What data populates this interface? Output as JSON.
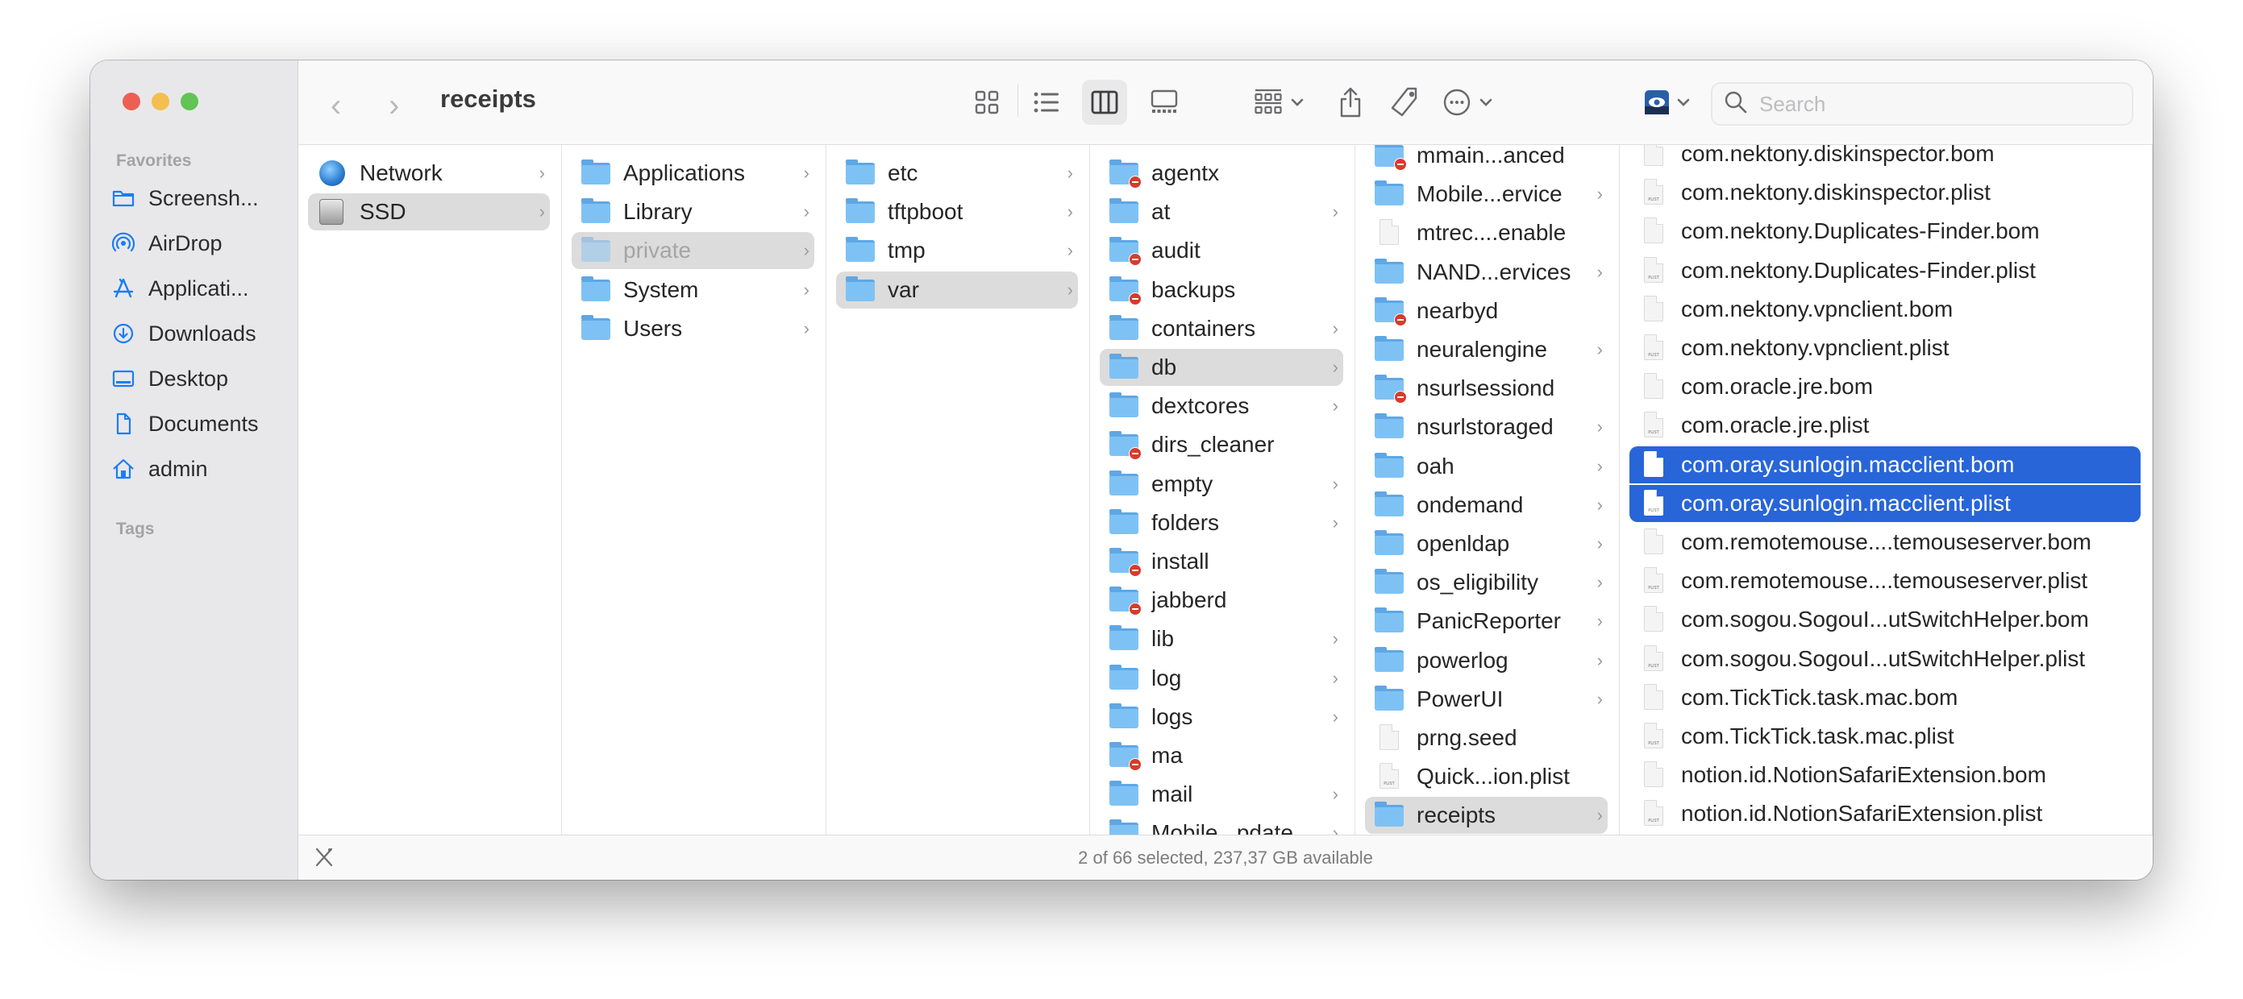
{
  "window": {
    "title": "receipts",
    "traffic_lights": [
      "close",
      "minimize",
      "zoom"
    ]
  },
  "sidebar": {
    "favorites_label": "Favorites",
    "tags_label": "Tags",
    "items": [
      {
        "label": "Screensh...",
        "icon": "folder-icon"
      },
      {
        "label": "AirDrop",
        "icon": "airdrop-icon"
      },
      {
        "label": "Applicati...",
        "icon": "applications-icon"
      },
      {
        "label": "Downloads",
        "icon": "download-icon"
      },
      {
        "label": "Desktop",
        "icon": "desktop-icon"
      },
      {
        "label": "Documents",
        "icon": "document-icon"
      },
      {
        "label": "admin",
        "icon": "home-icon"
      }
    ],
    "accent": "#1a7cf5"
  },
  "toolbar": {
    "back": "‹",
    "forward": "›",
    "view_modes": [
      "icon-view",
      "list-view",
      "column-view",
      "gallery-view"
    ],
    "active_view": "column-view",
    "group_by": "group-icon",
    "share": "share-icon",
    "tag": "tag-icon",
    "more": "more-icon",
    "preview": "preview-eye-icon",
    "search_placeholder": "Search",
    "search_value": ""
  },
  "columns": [
    {
      "items": [
        {
          "name": "Network",
          "type": "network",
          "arrow": true
        },
        {
          "name": "SSD",
          "type": "disk",
          "arrow": true,
          "state": "path"
        }
      ]
    },
    {
      "items": [
        {
          "name": "Applications",
          "type": "folder",
          "arrow": true
        },
        {
          "name": "Library",
          "type": "folder",
          "arrow": true
        },
        {
          "name": "private",
          "type": "folder",
          "arrow": true,
          "state": "path",
          "hidden": true
        },
        {
          "name": "System",
          "type": "folder",
          "arrow": true
        },
        {
          "name": "Users",
          "type": "folder",
          "arrow": true
        }
      ]
    },
    {
      "items": [
        {
          "name": "etc",
          "type": "folder",
          "arrow": true
        },
        {
          "name": "tftpboot",
          "type": "folder",
          "arrow": true
        },
        {
          "name": "tmp",
          "type": "folder",
          "arrow": true
        },
        {
          "name": "var",
          "type": "folder",
          "arrow": true,
          "state": "path"
        }
      ]
    },
    {
      "items": [
        {
          "name": "agentx",
          "type": "folder",
          "locked": true
        },
        {
          "name": "at",
          "type": "folder",
          "arrow": true
        },
        {
          "name": "audit",
          "type": "folder",
          "locked": true
        },
        {
          "name": "backups",
          "type": "folder",
          "locked": true
        },
        {
          "name": "containers",
          "type": "folder",
          "arrow": true
        },
        {
          "name": "db",
          "type": "folder",
          "arrow": true,
          "state": "path"
        },
        {
          "name": "dextcores",
          "type": "folder",
          "arrow": true
        },
        {
          "name": "dirs_cleaner",
          "type": "folder",
          "locked": true
        },
        {
          "name": "empty",
          "type": "folder",
          "arrow": true
        },
        {
          "name": "folders",
          "type": "folder",
          "arrow": true
        },
        {
          "name": "install",
          "type": "folder",
          "locked": true
        },
        {
          "name": "jabberd",
          "type": "folder",
          "locked": true
        },
        {
          "name": "lib",
          "type": "folder",
          "arrow": true
        },
        {
          "name": "log",
          "type": "folder",
          "arrow": true
        },
        {
          "name": "logs",
          "type": "folder",
          "arrow": true
        },
        {
          "name": "ma",
          "type": "folder",
          "locked": true
        },
        {
          "name": "mail",
          "type": "folder",
          "arrow": true
        },
        {
          "name": "Mobile...pdate",
          "type": "folder",
          "arrow": true
        }
      ]
    },
    {
      "items": [
        {
          "name": "mmain...anced",
          "type": "folder",
          "locked": true
        },
        {
          "name": "Mobile...ervice",
          "type": "folder",
          "arrow": true
        },
        {
          "name": "mtrec....enable",
          "type": "file"
        },
        {
          "name": "NAND...ervices",
          "type": "folder",
          "arrow": true
        },
        {
          "name": "nearbyd",
          "type": "folder",
          "locked": true
        },
        {
          "name": "neuralengine",
          "type": "folder",
          "arrow": true
        },
        {
          "name": "nsurlsessiond",
          "type": "folder",
          "locked": true
        },
        {
          "name": "nsurlstoraged",
          "type": "folder",
          "arrow": true
        },
        {
          "name": "oah",
          "type": "folder",
          "arrow": true
        },
        {
          "name": "ondemand",
          "type": "folder",
          "arrow": true
        },
        {
          "name": "openldap",
          "type": "folder",
          "arrow": true
        },
        {
          "name": "os_eligibility",
          "type": "folder",
          "arrow": true
        },
        {
          "name": "PanicReporter",
          "type": "folder",
          "arrow": true
        },
        {
          "name": "powerlog",
          "type": "folder",
          "arrow": true
        },
        {
          "name": "PowerUI",
          "type": "folder",
          "arrow": true
        },
        {
          "name": "prng.seed",
          "type": "file"
        },
        {
          "name": "Quick...ion.plist",
          "type": "plist"
        },
        {
          "name": "receipts",
          "type": "folder",
          "arrow": true,
          "state": "path"
        }
      ]
    },
    {
      "items": [
        {
          "name": "com.nektony.diskinspector.bom",
          "type": "file"
        },
        {
          "name": "com.nektony.diskinspector.plist",
          "type": "plist"
        },
        {
          "name": "com.nektony.Duplicates-Finder.bom",
          "type": "file"
        },
        {
          "name": "com.nektony.Duplicates-Finder.plist",
          "type": "plist"
        },
        {
          "name": "com.nektony.vpnclient.bom",
          "type": "file"
        },
        {
          "name": "com.nektony.vpnclient.plist",
          "type": "plist"
        },
        {
          "name": "com.oracle.jre.bom",
          "type": "file"
        },
        {
          "name": "com.oracle.jre.plist",
          "type": "plist"
        },
        {
          "name": "com.oray.sunlogin.macclient.bom",
          "type": "file",
          "state": "selected"
        },
        {
          "name": "com.oray.sunlogin.macclient.plist",
          "type": "plist",
          "state": "selected"
        },
        {
          "name": "com.remotemouse....temouseserver.bom",
          "type": "file"
        },
        {
          "name": "com.remotemouse....temouseserver.plist",
          "type": "plist"
        },
        {
          "name": "com.sogou.SogouI...utSwitchHelper.bom",
          "type": "file"
        },
        {
          "name": "com.sogou.SogouI...utSwitchHelper.plist",
          "type": "plist"
        },
        {
          "name": "com.TickTick.task.mac.bom",
          "type": "file"
        },
        {
          "name": "com.TickTick.task.mac.plist",
          "type": "plist"
        },
        {
          "name": "notion.id.NotionSafariExtension.bom",
          "type": "file"
        },
        {
          "name": "notion.id.NotionSafariExtension.plist",
          "type": "plist"
        }
      ]
    }
  ],
  "plist_label": "PLIST",
  "arrow_glyph": "›",
  "status": {
    "text": "2 of 66 selected, 237,37 GB available"
  },
  "colors": {
    "selection_blue": "#2865d8",
    "path_gray": "#dcdcdc",
    "folder_blue": "#7ec2f5",
    "no_entry_red": "#d83b2a"
  }
}
